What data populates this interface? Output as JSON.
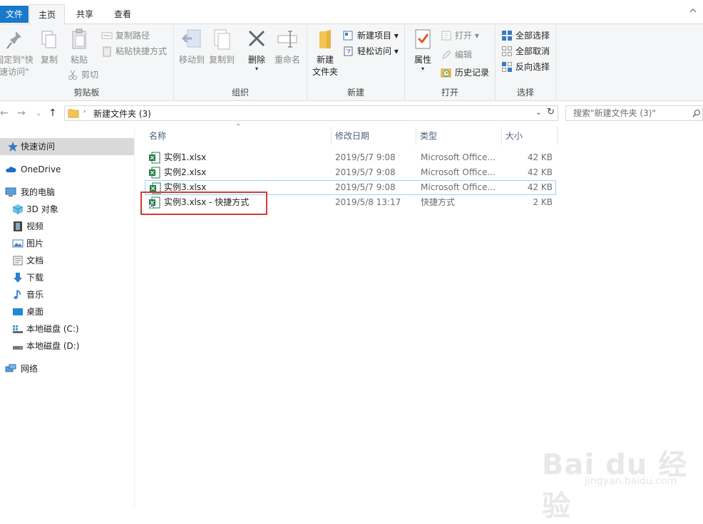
{
  "tabs": {
    "file": "文件",
    "home": "主页",
    "share": "共享",
    "view": "查看"
  },
  "ribbon": {
    "clipboard": {
      "label": "剪贴板",
      "pin_line1": "固定到\"快",
      "pin_line2": "速访问\"",
      "copy": "复制",
      "paste": "粘贴",
      "copy_path": "复制路径",
      "paste_shortcut": "粘贴快捷方式",
      "cut": "剪切"
    },
    "organize": {
      "label": "组织",
      "move_to": "移动到",
      "copy_to": "复制到",
      "delete": "删除",
      "rename": "重命名"
    },
    "new": {
      "label": "新建",
      "new_folder_line1": "新建",
      "new_folder_line2": "文件夹",
      "new_item": "新建项目",
      "easy_access": "轻松访问"
    },
    "open": {
      "label": "打开",
      "properties": "属性",
      "open": "打开",
      "edit": "编辑",
      "history": "历史记录"
    },
    "select": {
      "label": "选择",
      "select_all": "全部选择",
      "select_none": "全部取消",
      "invert": "反向选择"
    }
  },
  "address": {
    "path": "新建文件夹 (3)",
    "search_placeholder": "搜索\"新建文件夹 (3)\""
  },
  "nav": {
    "items": [
      "快速访问",
      "OneDrive",
      "我的电脑",
      "3D 对象",
      "视频",
      "图片",
      "文档",
      "下载",
      "音乐",
      "桌面",
      "本地磁盘 (C:)",
      "本地磁盘 (D:)",
      "网络"
    ]
  },
  "columns": {
    "name": "名称",
    "date": "修改日期",
    "type": "类型",
    "size": "大小"
  },
  "files": [
    {
      "name": "实例1.xlsx",
      "date": "2019/5/7 9:08",
      "type": "Microsoft Office...",
      "size": "42 KB"
    },
    {
      "name": "实例2.xlsx",
      "date": "2019/5/7 9:08",
      "type": "Microsoft Office...",
      "size": "42 KB"
    },
    {
      "name": "实例3.xlsx",
      "date": "2019/5/7 9:08",
      "type": "Microsoft Office...",
      "size": "42 KB"
    },
    {
      "name": "实例3.xlsx - 快捷方式",
      "date": "2019/5/8 13:17",
      "type": "快捷方式",
      "size": "2 KB"
    }
  ],
  "watermark": {
    "brand": "Bai du 经验",
    "url": "jingyan.baidu.com"
  },
  "colors": {
    "accent": "#1979ca",
    "highlight": "#d33b3b",
    "selected_bg": "#cce8ff"
  }
}
